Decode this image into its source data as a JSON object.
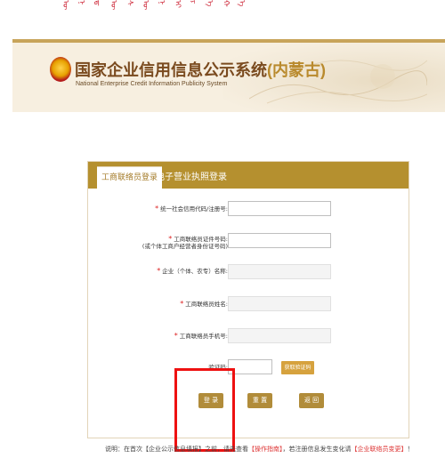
{
  "header": {
    "mongolian_glyphs": [
      "ᠦ",
      "ᠨ",
      "ᠳ",
      "ᠦ",
      "ᠰ",
      "ᠦ",
      "ᠨ",
      "ᠢ",
      "ᠶ",
      "ᠡ",
      "ᠬ",
      "ᠡ"
    ],
    "title_main": "国家企业信用信息公示系统",
    "title_region": "(内蒙古)",
    "subtitle": "National Enterprise Credit Information Publicity System"
  },
  "tabs": {
    "liaison_login": "工商联络员登录",
    "license_login": "电子营业执照登录"
  },
  "form": {
    "credit_code_label": "统一社会信用代码/注册号:",
    "id_label_line1": "工商联络员证件号码:",
    "id_label_line2": "(或个体工商户经营者身份证号码)",
    "company_name_label": "企业（个体、农专）名称:",
    "liaison_name_label": "工商联络员姓名:",
    "liaison_phone_label": "工商联络员手机号:",
    "captcha_label": "验证码:",
    "required_mark": "*"
  },
  "buttons": {
    "get_code": "获取验证码",
    "login": "登 录",
    "reset": "重 置",
    "back": "返 回"
  },
  "footer": {
    "prefix": "说明：在首次【企业公示信息填报】之前，请先查看",
    "link1": "【操作指南】",
    "middle": "，若注册信息发生变化请",
    "link2": "【企业联络员变更】",
    "suffix": "！"
  },
  "colors": {
    "accent_gold": "#b5902f",
    "highlight_red": "#e11111"
  }
}
